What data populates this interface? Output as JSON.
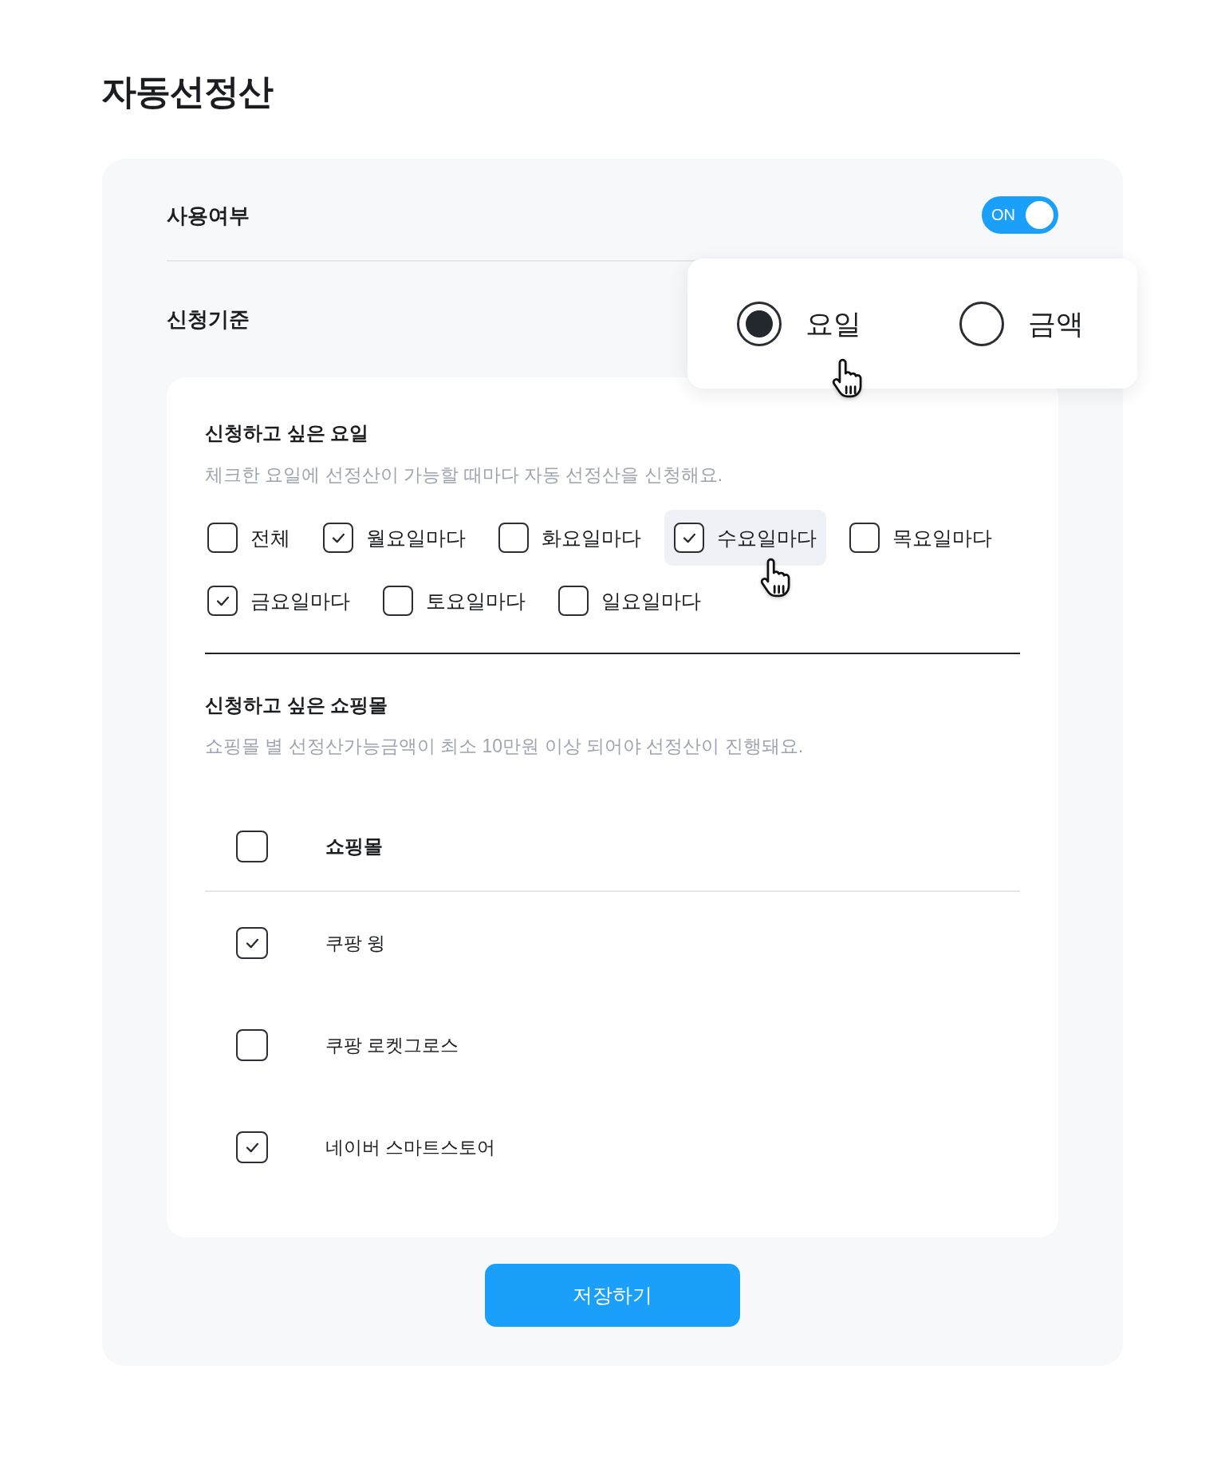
{
  "page_title": "자동선정산",
  "usage": {
    "label": "사용여부",
    "toggle": {
      "text": "ON",
      "on": true
    }
  },
  "criteria": {
    "label": "신청기준",
    "options": [
      {
        "label": "요일",
        "selected": true,
        "hovered": true
      },
      {
        "label": "금액",
        "selected": false,
        "hovered": false
      }
    ]
  },
  "days_section": {
    "title": "신청하고 싶은 요일",
    "description": "체크한 요일에 선정산이 가능할 때마다 자동 선정산을 신청해요.",
    "days": [
      {
        "label": "전체",
        "checked": false,
        "hovered": false
      },
      {
        "label": "월요일마다",
        "checked": true,
        "hovered": false
      },
      {
        "label": "화요일마다",
        "checked": false,
        "hovered": false
      },
      {
        "label": "수요일마다",
        "checked": true,
        "hovered": true
      },
      {
        "label": "목요일마다",
        "checked": false,
        "hovered": false
      },
      {
        "label": "금요일마다",
        "checked": true,
        "hovered": false
      },
      {
        "label": "토요일마다",
        "checked": false,
        "hovered": false
      },
      {
        "label": "일요일마다",
        "checked": false,
        "hovered": false
      }
    ]
  },
  "malls_section": {
    "title": "신청하고 싶은 쇼핑몰",
    "description": "쇼핑몰 별 선정산가능금액이 최소 10만원 이상 되어야 선정산이 진행돼요.",
    "table": {
      "header": {
        "checked": false,
        "label": "쇼핑몰"
      },
      "rows": [
        {
          "name": "쿠팡 윙",
          "checked": true
        },
        {
          "name": "쿠팡 로켓그로스",
          "checked": false
        },
        {
          "name": "네이버 스마트스토어",
          "checked": true
        }
      ]
    }
  },
  "save_button": {
    "label": "저장하기"
  }
}
